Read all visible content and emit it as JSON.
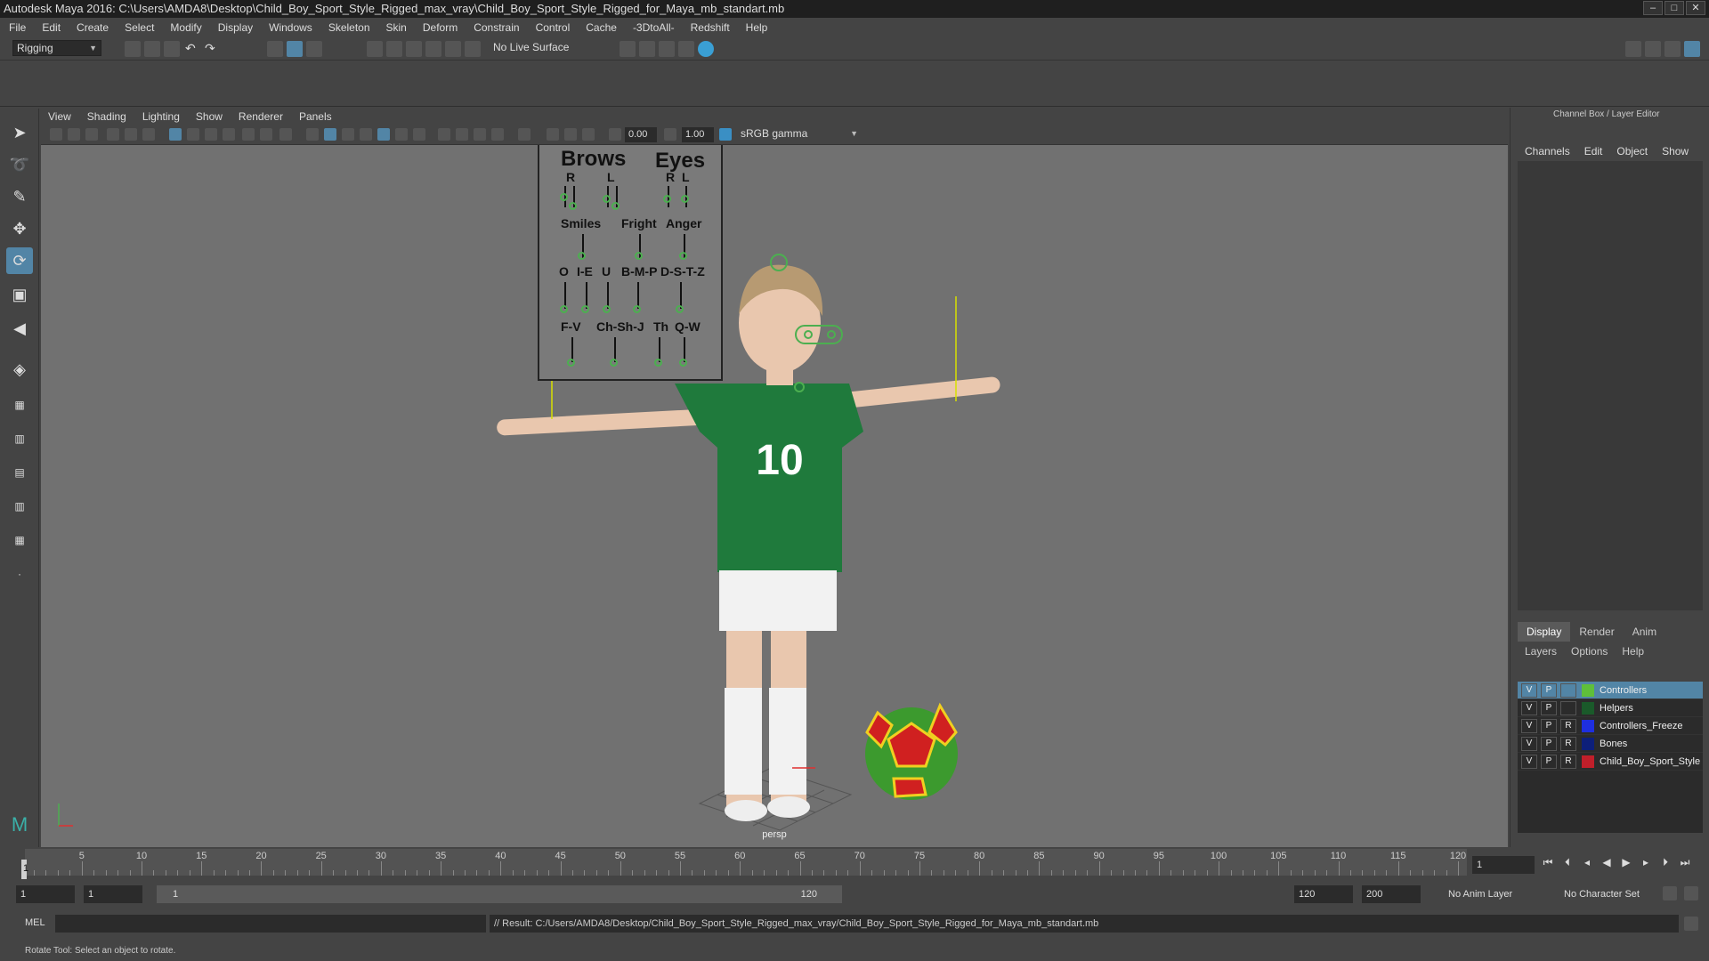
{
  "title": "Autodesk Maya 2016: C:\\Users\\AMDA8\\Desktop\\Child_Boy_Sport_Style_Rigged_max_vray\\Child_Boy_Sport_Style_Rigged_for_Maya_mb_standart.mb",
  "window_buttons": [
    "–",
    "□",
    "✕"
  ],
  "menu": [
    "File",
    "Edit",
    "Create",
    "Select",
    "Modify",
    "Display",
    "Windows",
    "Skeleton",
    "Skin",
    "Deform",
    "Constrain",
    "Control",
    "Cache",
    "-3DtoAll-",
    "Redshift",
    "Help"
  ],
  "shelf": {
    "menuset": "Rigging",
    "live_surface": "No Live Surface"
  },
  "viewport": {
    "menu": [
      "View",
      "Shading",
      "Lighting",
      "Show",
      "Renderer",
      "Panels"
    ],
    "gamma_value1": "0.00",
    "gamma_value2": "1.00",
    "color_space": "sRGB gamma",
    "camera": "persp",
    "face_panel": {
      "brows": "Brows",
      "eyes": "Eyes",
      "r": "R",
      "l": "L",
      "smiles": "Smiles",
      "fright": "Fright",
      "anger": "Anger",
      "o": "O",
      "ie": "I-E",
      "u": "U",
      "bmp": "B-M-P",
      "dstz": "D-S-T-Z",
      "fv": "F-V",
      "chshj": "Ch-Sh-J",
      "th": "Th",
      "qw": "Q-W"
    }
  },
  "right_panel": {
    "title": "Channel Box / Layer Editor",
    "channel_tabs": [
      "Channels",
      "Edit",
      "Object",
      "Show"
    ],
    "layer_tabs": [
      "Display",
      "Render",
      "Anim"
    ],
    "layer_menu": [
      "Layers",
      "Options",
      "Help"
    ],
    "layers": [
      {
        "v": "V",
        "p": "P",
        "r": "",
        "name": "Controllers",
        "color": "#5fbf3a",
        "selected": true
      },
      {
        "v": "V",
        "p": "P",
        "r": "",
        "name": "Helpers",
        "color": "#1a5a2a",
        "selected": false
      },
      {
        "v": "V",
        "p": "P",
        "r": "R",
        "name": "Controllers_Freeze",
        "color": "#1e2fe0",
        "selected": false
      },
      {
        "v": "V",
        "p": "P",
        "r": "R",
        "name": "Bones",
        "color": "#0d1f7a",
        "selected": false
      },
      {
        "v": "V",
        "p": "P",
        "r": "R",
        "name": "Child_Boy_Sport_Style",
        "color": "#c01f2a",
        "selected": false
      }
    ]
  },
  "timeline": {
    "ticks": [
      "5",
      "10",
      "15",
      "20",
      "25",
      "30",
      "35",
      "40",
      "45",
      "50",
      "55",
      "60",
      "65",
      "70",
      "75",
      "80",
      "85",
      "90",
      "95",
      "100",
      "105",
      "110",
      "115",
      "120"
    ],
    "current_frame_marker": "1",
    "current_frame": "1"
  },
  "range": {
    "start": "1",
    "anim_start": "1",
    "slider_start": "1",
    "slider_end": "120",
    "end": "120",
    "anim_end": "200",
    "anim_layer": "No Anim Layer",
    "character_set": "No Character Set"
  },
  "command": {
    "label": "MEL",
    "result": "// Result: C:/Users/AMDA8/Desktop/Child_Boy_Sport_Style_Rigged_max_vray/Child_Boy_Sport_Style_Rigged_for_Maya_mb_standart.mb"
  },
  "status": "Rotate Tool: Select an object to rotate."
}
